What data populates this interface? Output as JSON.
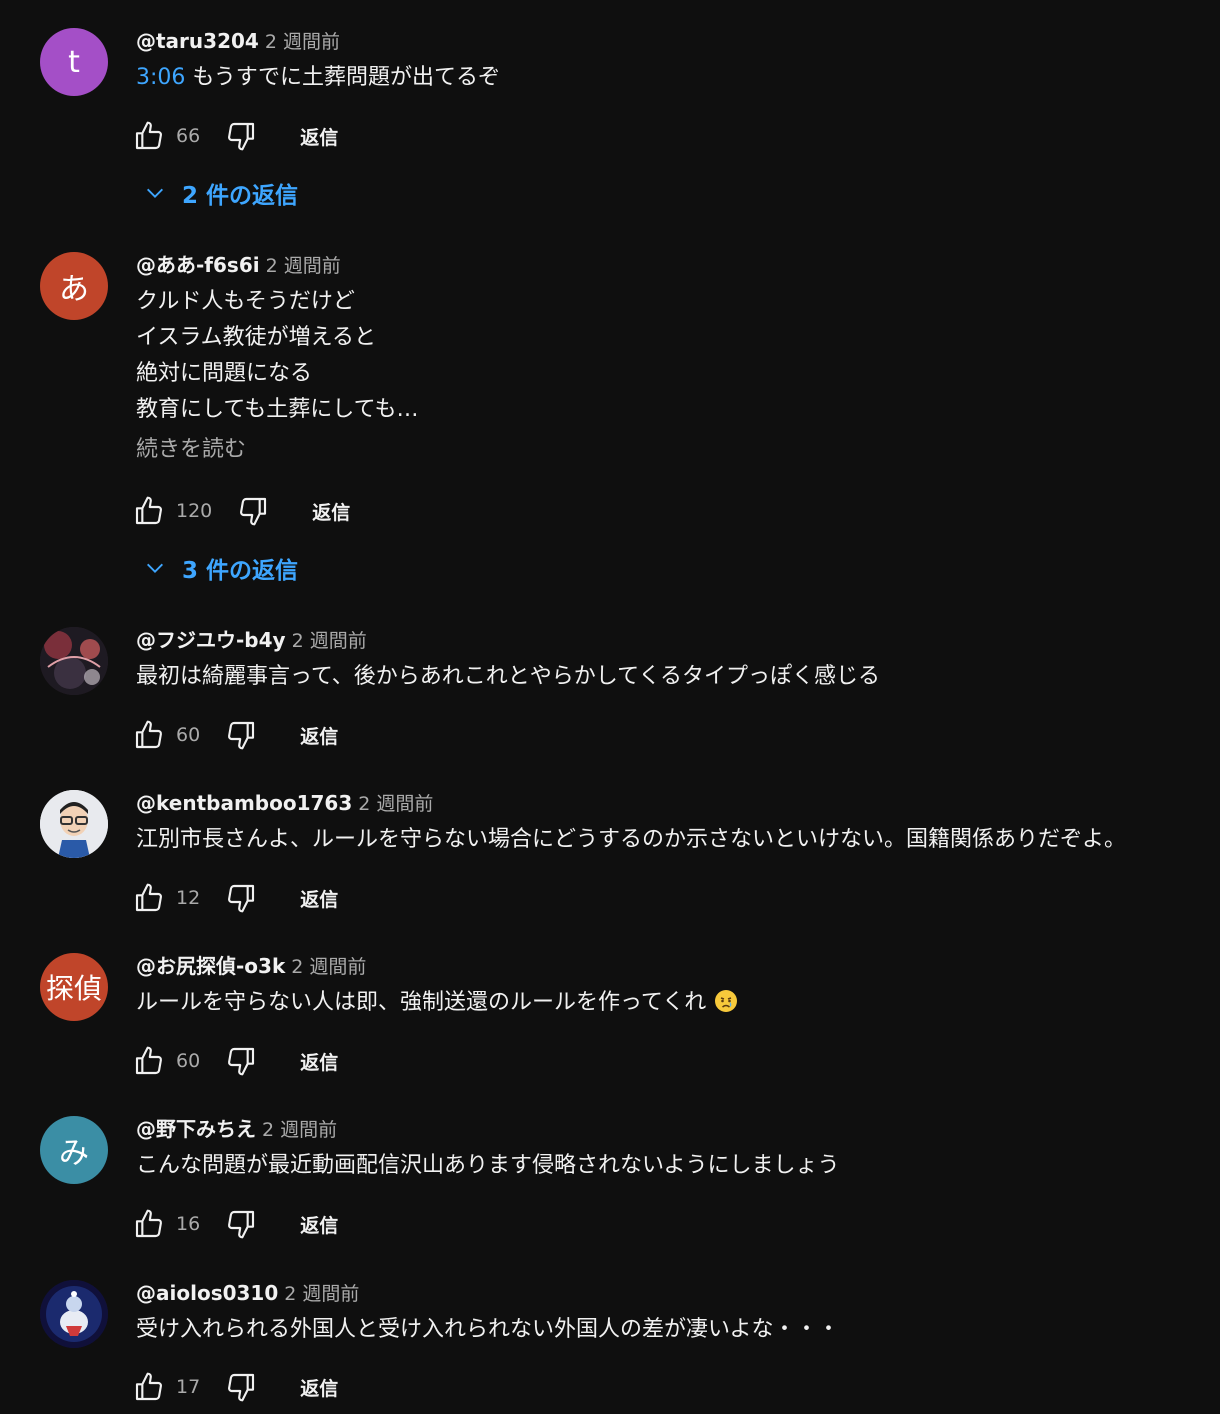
{
  "reply_label": "返信",
  "comments": [
    {
      "author": "@taru3204",
      "time": "2 週間前",
      "timestamp": "3:06",
      "text": "もうすでに土葬問題が出てるぞ",
      "likes": "66",
      "avatar_letter": "t",
      "avatar_color": "#a44fc7",
      "replies_label": "2 件の返信"
    },
    {
      "author": "@ああ-f6s6i",
      "time": "2 週間前",
      "text": "クルド人もそうだけど\nイスラム教徒が増えると\n絶対に問題になる\n教育にしても土葬にしても…",
      "read_more": "続きを読む",
      "likes": "120",
      "avatar_letter": "あ",
      "avatar_color": "#c0452a",
      "replies_label": "3 件の返信"
    },
    {
      "author": "@フジユウ-b4y",
      "time": "2 週間前",
      "text": "最初は綺麗事言って、後からあれこれとやらかしてくるタイプっぽく感じる",
      "likes": "60"
    },
    {
      "author": "@kentbamboo1763",
      "time": "2 週間前",
      "text": "江別市長さんよ、ルールを守らない場合にどうするのか示さないといけない。国籍関係ありだぞよ。",
      "likes": "12"
    },
    {
      "author": "@お尻探偵-o3k",
      "time": "2 週間前",
      "text": "ルールを守らない人は即、強制送還のルールを作ってくれ",
      "likes": "60",
      "avatar_letter": "探偵",
      "avatar_color": "#c0452a",
      "emoji": "crying-face"
    },
    {
      "author": "@野下みちえ",
      "time": "2 週間前",
      "text": "こんな問題が最近動画配信沢山あります侵略されないようにしましょう",
      "likes": "16",
      "avatar_letter": "み",
      "avatar_color": "#3b8ea5"
    },
    {
      "author": "@aiolos0310",
      "time": "2 週間前",
      "text": "受け入れられる外国人と受け入れられない外国人の差が凄いよな・・・",
      "likes": "17"
    }
  ]
}
